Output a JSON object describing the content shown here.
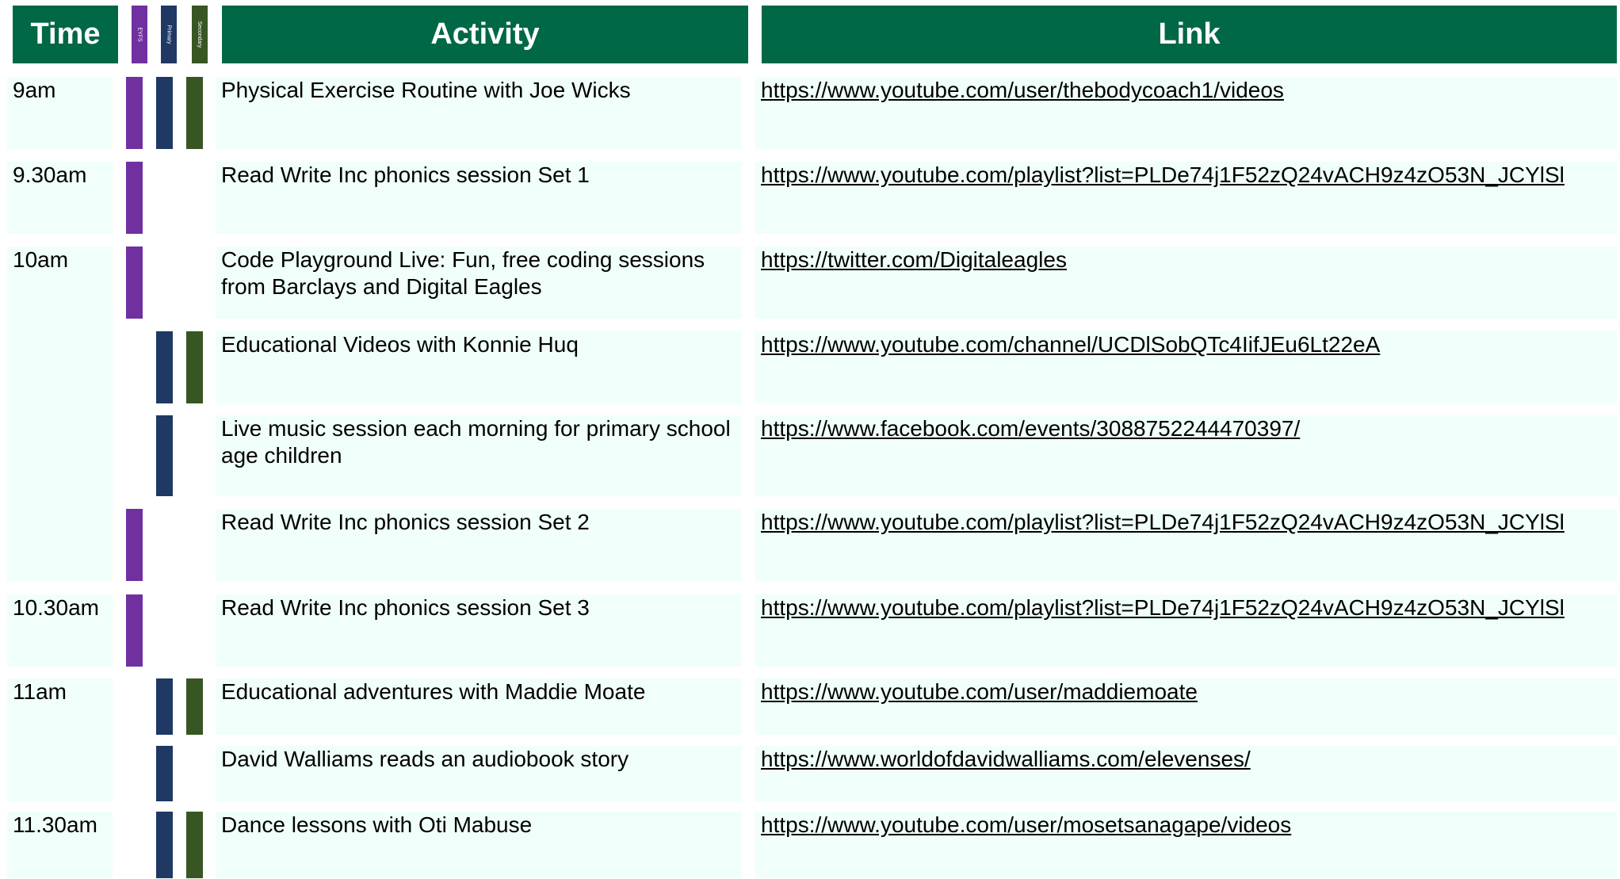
{
  "header": {
    "time": "Time",
    "activity": "Activity",
    "link": "Link"
  },
  "stages": {
    "eyfs": "EYFS",
    "primary": "Primary",
    "secondary": "Secondary"
  },
  "colors": {
    "header_bg": "#006846",
    "row_bg": "#f0fff9",
    "eyfs": "#7030a0",
    "primary": "#1f3864",
    "secondary": "#375623"
  },
  "rows": [
    {
      "time": "9am",
      "activity": "Physical Exercise Routine with Joe Wicks",
      "link": "https://www.youtube.com/user/thebodycoach1/videos",
      "eyfs": true,
      "primary": true,
      "secondary": true
    },
    {
      "time": "9.30am",
      "activity": "Read Write Inc phonics session Set 1",
      "link": "https://www.youtube.com/playlist?list=PLDe74j1F52zQ24vACH9z4zO53N_JCYlSl",
      "eyfs": true,
      "primary": false,
      "secondary": false
    },
    {
      "time": "10am",
      "activity": "Code Playground Live: Fun, free coding sessions from Barclays and Digital Eagles",
      "link": "https://twitter.com/Digitaleagles",
      "eyfs": true,
      "primary": false,
      "secondary": false
    },
    {
      "time": "",
      "activity": "Educational Videos with Konnie Huq",
      "link": "https://www.youtube.com/channel/UCDlSobQTc4IifJEu6Lt22eA",
      "eyfs": false,
      "primary": true,
      "secondary": true
    },
    {
      "time": "",
      "activity": "Live music session each morning for primary school age children",
      "link": "https://www.facebook.com/events/3088752244470397/",
      "eyfs": false,
      "primary": true,
      "secondary": false
    },
    {
      "time": "",
      "activity": "Read Write Inc phonics session Set 2",
      "link": "https://www.youtube.com/playlist?list=PLDe74j1F52zQ24vACH9z4zO53N_JCYlSl",
      "eyfs": true,
      "primary": false,
      "secondary": false
    },
    {
      "time": "10.30am",
      "activity": "Read Write Inc phonics session Set 3",
      "link": "https://www.youtube.com/playlist?list=PLDe74j1F52zQ24vACH9z4zO53N_JCYlSl",
      "eyfs": true,
      "primary": false,
      "secondary": false
    },
    {
      "time": "11am",
      "activity": "Educational adventures with Maddie Moate",
      "link": "https://www.youtube.com/user/maddiemoate",
      "eyfs": false,
      "primary": true,
      "secondary": true
    },
    {
      "time": "",
      "activity": "David Walliams reads an audiobook story",
      "link": "https://www.worldofdavidwalliams.com/elevenses/",
      "eyfs": false,
      "primary": true,
      "secondary": false
    },
    {
      "time": "11.30am",
      "activity": "Dance lessons with Oti Mabuse",
      "link": "https://www.youtube.com/user/mosetsanagape/videos",
      "eyfs": false,
      "primary": true,
      "secondary": true
    }
  ]
}
